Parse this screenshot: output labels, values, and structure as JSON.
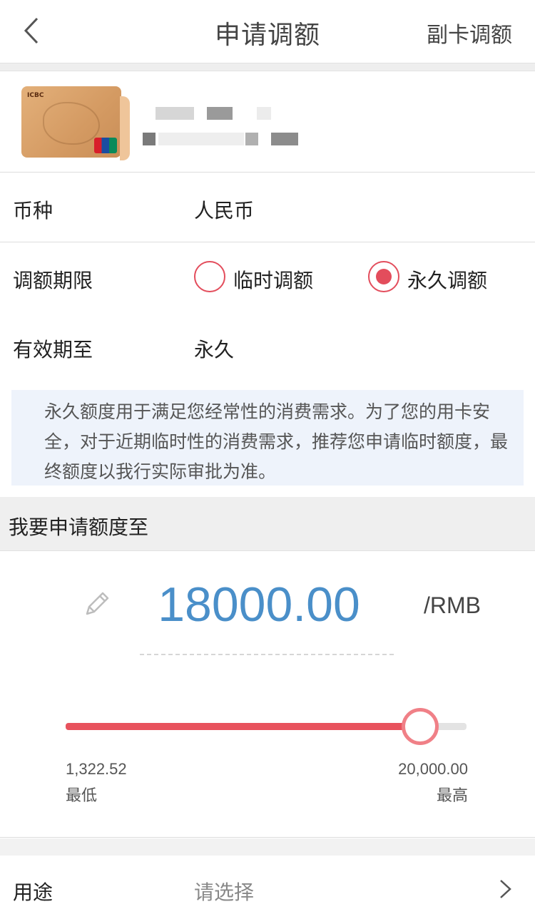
{
  "nav": {
    "title": "申请调额",
    "right_action": "副卡调额"
  },
  "form": {
    "currency_label": "币种",
    "currency_value": "人民币",
    "term_label": "调额期限",
    "term_options": [
      {
        "label": "临时调额",
        "selected": false
      },
      {
        "label": "永久调额",
        "selected": true
      }
    ],
    "valid_label": "有效期至",
    "valid_value": "永久"
  },
  "notice": "永久额度用于满足您经常性的消费需求。为了您的用卡安全，对于近期临时性的消费需求，推荐您申请临时额度，最终额度以我行实际审批为准。",
  "amount_section": {
    "heading": "我要申请额度至",
    "amount": "18000.00",
    "unit": "/RMB",
    "slider": {
      "min_value": "1,322.52",
      "min_label": "最低",
      "max_value": "20,000.00",
      "max_label": "最高",
      "fraction": 0.885
    }
  },
  "purpose": {
    "label": "用途",
    "placeholder": "请选择"
  },
  "colors": {
    "accent": "#e8525d",
    "amount_blue": "#4a8fc9",
    "notice_bg": "#eef3fb"
  }
}
